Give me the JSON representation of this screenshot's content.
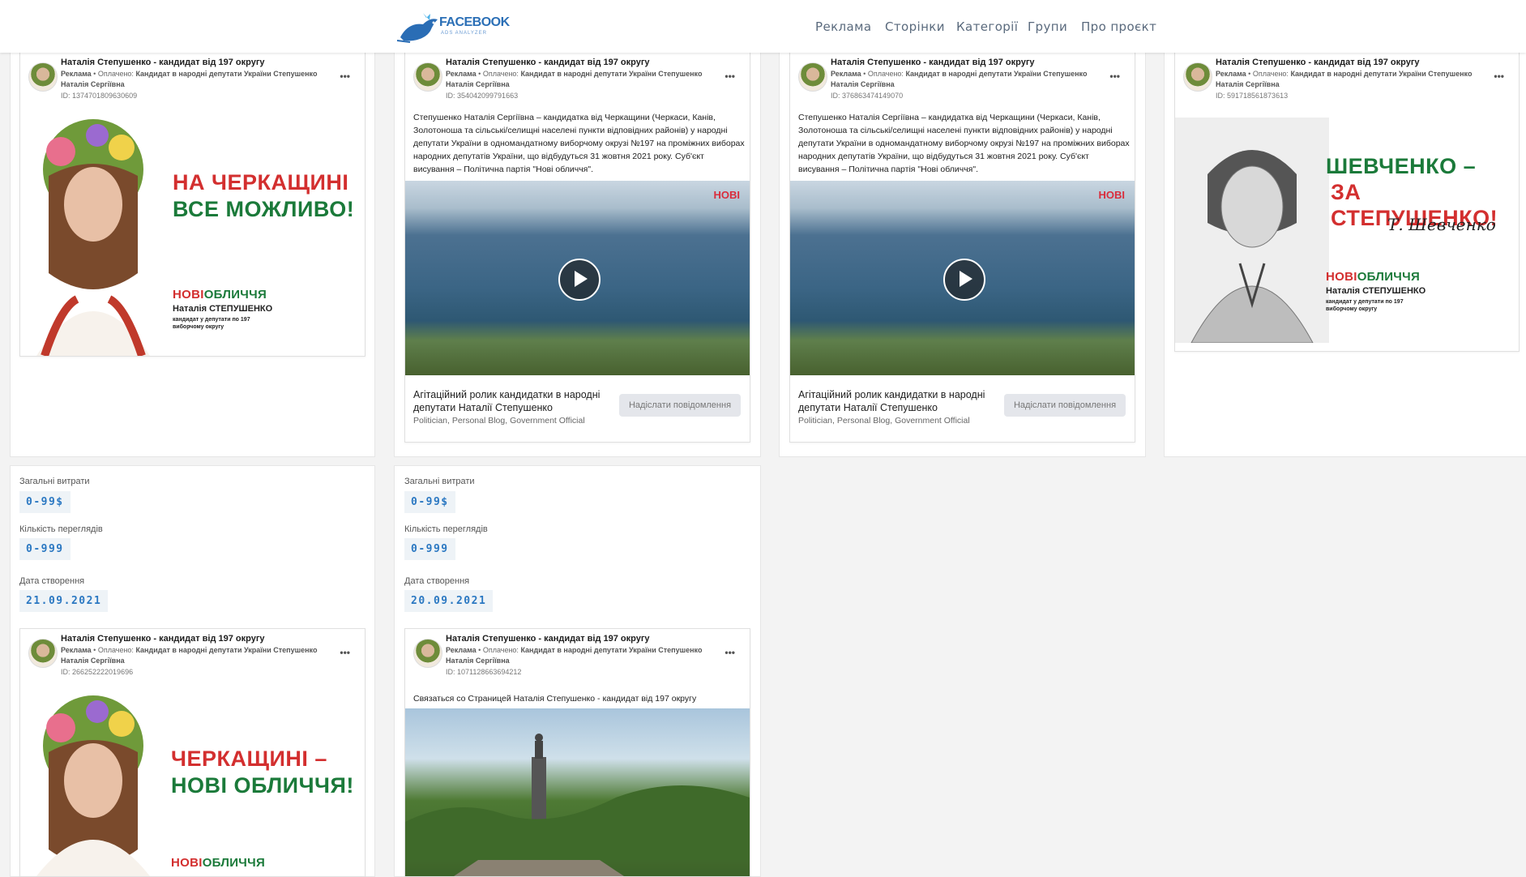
{
  "header": {
    "logo_text": "FACEBOOK",
    "logo_sub": "ADS ANALYZER",
    "nav": [
      "Реклама",
      "Сторінки",
      "Категорії",
      "Групи",
      "Про проєкт"
    ]
  },
  "post": {
    "author": "Наталія Степушенко - кандидат від 197 округу",
    "ad_label": "Реклама",
    "paid_label": "Оплачено:",
    "paid_by": "Кандидат в народні депутати України Степушенко Наталія Сергіївна"
  },
  "cards": [
    {
      "id": "ID: 1374701809630609",
      "slogan_red": "НА ЧЕРКАЩИНІ",
      "slogan_green": "ВСЕ МОЖЛИВО!",
      "brand_red": "НОВІ",
      "brand_green": "ОБЛИЧЧЯ",
      "name": "Наталія СТЕПУШЕНКО",
      "sub": "кандидат у депутати по 197 виборчому округу"
    },
    {
      "id": "ID: 354042099791663",
      "text": "Степушенко Наталія Сергіївна – кандидатка від Черкащини (Черкаси, Канів, Золотоноша та сільські/селищні населені пункти відповідних районів) у народні депутати України в одномандатному виборчому окрузі №197 на проміжних виборах народних депутатів України, що відбудуться 31 жовтня 2021 року. Суб'єкт висування – Політична партія \"Нові обличчя\".",
      "video_logo": "НОВІ",
      "caption": "Агітаційний ролик кандидатки в народні депутати Наталії Степушенко",
      "caption_sub": "Politician, Personal Blog, Government Official",
      "button": "Надіслати повідомлення"
    },
    {
      "id": "ID: 376863474149070",
      "text": "Степушенко Наталія Сергіївна – кандидатка від Черкащини (Черкаси, Канів, Золотоноша та сільські/селищні населені пункти відповідних районів) у народні депутати України в одномандатному виборчому окрузі №197 на проміжних виборах народних депутатів України, що відбудуться 31 жовтня 2021 року. Суб'єкт висування – Політична партія \"Нові обличчя\".",
      "video_logo": "НОВІ",
      "caption": "Агітаційний ролик кандидатки в народні депутати Наталії Степушенко",
      "caption_sub": "Politician, Personal Blog, Government Official",
      "button": "Надіслати повідомлення"
    },
    {
      "id": "ID: 591718561873613",
      "slogan_green": "ШЕВЧЕНКО –",
      "slogan_red": "ЗА СТЕПУШЕНКО!",
      "signature": "Т. Шевченко",
      "brand_red": "НОВІ",
      "brand_green": "ОБЛИЧЧЯ",
      "name": "Наталія СТЕПУШЕНКО",
      "sub": "кандидат у депутати по 197 виборчому округу"
    },
    {
      "id": "ID: 266252222019696",
      "slogan_red": "ЧЕРКАЩИНІ –",
      "slogan_green": "НОВІ ОБЛИЧЧЯ!",
      "brand_red": "НОВІ",
      "brand_green": "ОБЛИЧЧЯ"
    },
    {
      "id": "ID: 1071128663694212",
      "text": "Связаться со Страницей Наталія Степушенко - кандидат від 197 округу"
    }
  ],
  "stats": [
    {
      "spend_label": "Загальні витрати",
      "spend": "0-99$",
      "views_label": "Кількість переглядів",
      "views": "0-999",
      "date_label": "Дата створення",
      "date": "21.09.2021"
    },
    {
      "spend_label": "Загальні витрати",
      "spend": "0-99$",
      "views_label": "Кількість переглядів",
      "views": "0-999",
      "date_label": "Дата створення",
      "date": "20.09.2021"
    }
  ],
  "colors": {
    "brand_red": "#d32f2f",
    "brand_green": "#1b7a3a",
    "stat_value": "#2b78c2",
    "nav_text": "#5a6a7d"
  },
  "icons": [
    "facebook-bird-logo",
    "play-icon",
    "more-dots-icon"
  ]
}
